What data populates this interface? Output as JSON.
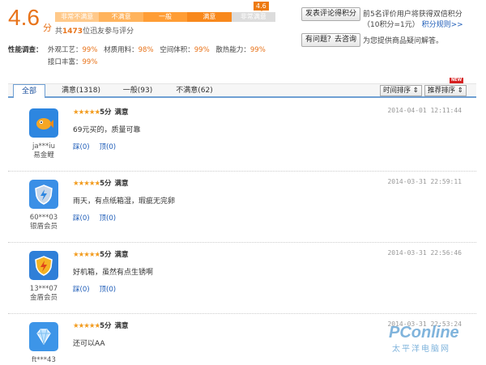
{
  "summary": {
    "score": "4.6",
    "score_unit": "分",
    "marker": "4.6",
    "scale": [
      "非常不满意",
      "不满意",
      "一般",
      "满意",
      "非常满意"
    ],
    "count_prefix": "共",
    "count": "1473",
    "count_suffix": "位迅友参与评分"
  },
  "quality": {
    "title": "性能调查：",
    "items": [
      {
        "label": "外观工艺：",
        "value": "99%"
      },
      {
        "label": "材质用料：",
        "value": "98%"
      },
      {
        "label": "空间体积：",
        "value": "99%"
      },
      {
        "label": "散热能力：",
        "value": "99%"
      },
      {
        "label": "接口丰富：",
        "value": "99%"
      }
    ]
  },
  "actions": {
    "post_button": "发表评论得积分",
    "post_text": "前5名评价用户将获得双倍积分",
    "post_text2": "（10积分=1元）",
    "rules_link": "积分规则>>",
    "ask_button": "有问题？去咨询",
    "ask_text": "为您提供商品疑问解答。"
  },
  "tabs": [
    {
      "label": "全部"
    },
    {
      "label": "满意(1318)"
    },
    {
      "label": "一般(93)"
    },
    {
      "label": "不满意(62)"
    }
  ],
  "sort": {
    "time": "时间排序 ⇕",
    "recommend": "推荐排序 ⇕",
    "new_tag": "NEW"
  },
  "reviews": [
    {
      "user": "ja***iu",
      "level": "易金鲤",
      "stars": "★★★★★",
      "score": "5分",
      "sat": "满意",
      "date": "2014-04-01 12:11:44",
      "text": "69元买的，质量可靠",
      "like": "踩(0)",
      "up": "顶(0)",
      "color": "#2d86e0"
    },
    {
      "user": "",
      "level": "",
      "stars": "★★★★★",
      "score": "5分",
      "sat": "满意",
      "date": "2014-03-31 22:59:11",
      "text": "雨天，有点纸箱湿，瑕疵无完卵",
      "like": "踩(0)",
      "up": "顶(0)",
      "color": "#3a8fe6"
    },
    {
      "user": "60***03",
      "level": "银盾会员",
      "stars": "★★★★★",
      "score": "5分",
      "sat": "满意",
      "date": "2014-03-31 22:56:46",
      "text": "好机箱，虽然有点生锈啊",
      "like": "踩(0)",
      "up": "顶(0)",
      "color": "#2f7fd8"
    },
    {
      "user": "13***07",
      "level": "金盾会员",
      "stars": "★★★★★",
      "score": "5分",
      "sat": "满意",
      "date": "2014-03-31 22:53:24",
      "text": "还可以AA",
      "like": "",
      "up": "",
      "color": "#3d95e8"
    }
  ],
  "last_user": "ft***43",
  "watermark": {
    "brand": "PConline",
    "sub": "太平洋电脑网"
  }
}
